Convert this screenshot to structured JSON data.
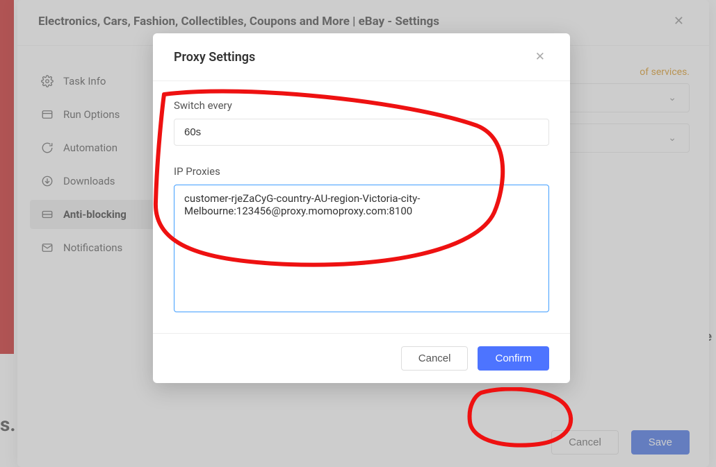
{
  "settings": {
    "title": "Electronics, Cars, Fashion, Collectibles, Coupons and More | eBay - Settings",
    "sidebar": {
      "items": [
        {
          "label": "Task Info"
        },
        {
          "label": "Run Options"
        },
        {
          "label": "Automation"
        },
        {
          "label": "Downloads"
        },
        {
          "label": "Anti-blocking"
        },
        {
          "label": "Notifications"
        }
      ]
    },
    "hint": "of services.",
    "footer": {
      "cancel": "Cancel",
      "save": "Save"
    }
  },
  "modal": {
    "title": "Proxy Settings",
    "switch_label": "Switch every",
    "switch_value": "60s",
    "ip_label": "IP Proxies",
    "ip_value": "customer-rjeZaCyG-country-AU-region-Victoria-city-Melbourne:123456@proxy.momoproxy.com:8100",
    "cancel": "Cancel",
    "confirm": "Confirm"
  },
  "bg": {
    "corner": "s.",
    "right_edge": "e"
  }
}
